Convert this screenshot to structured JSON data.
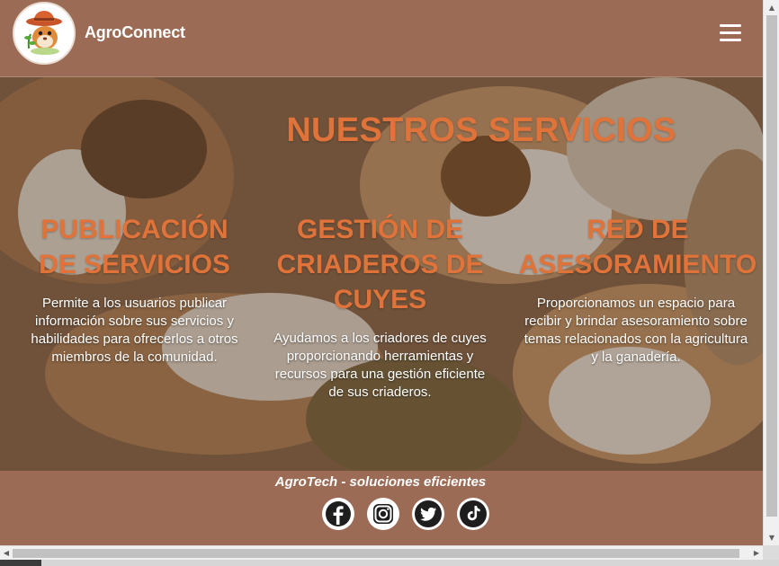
{
  "header": {
    "brand": "AgroConnect",
    "logo_icon": "guinea-pig-farmer-logo",
    "menu_icon": "hamburger-menu-icon"
  },
  "services": {
    "title": "NUESTROS SERVICIOS",
    "items": [
      {
        "title_lines": [
          "PUBLICACIÓN",
          "DE SERVICIOS"
        ],
        "description": "Permite a los usuarios publicar información sobre sus servicios y habilidades para ofrecerlos a otros miembros de la comunidad."
      },
      {
        "title_lines": [
          "GESTIÓN DE",
          "CRIADEROS DE",
          "CUYES"
        ],
        "description": "Ayudamos a los criadores de cuyes proporcionando herramientas y recursos para una gestión eficiente de sus criaderos."
      },
      {
        "title_lines": [
          "RED DE",
          "ASESORAMIENTO"
        ],
        "description": "Proporcionamos un espacio para recibir y brindar asesoramiento sobre temas relacionados con la agricultura y la ganadería."
      }
    ]
  },
  "footer": {
    "tagline": "AgroTech - soluciones eficientes",
    "social_icons": [
      "facebook-icon",
      "instagram-icon",
      "twitter-icon",
      "tiktok-icon"
    ]
  },
  "colors": {
    "brand_brown": "#9c6b55",
    "accent_orange": "#e0733a",
    "text_white": "#ffffff"
  }
}
